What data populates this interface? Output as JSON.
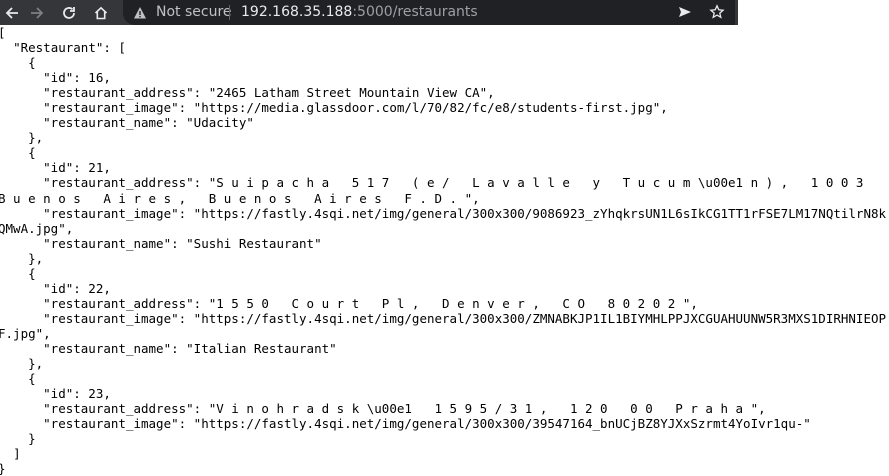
{
  "browser": {
    "security_label": "Not secure",
    "url_host": "192.168.35.188",
    "url_path": ":5000/restaurants"
  },
  "icons": {
    "back": "arrow-left-icon",
    "forward": "arrow-right-icon",
    "reload": "reload-icon",
    "home": "home-icon",
    "security": "warning-triangle-icon",
    "send": "send-icon",
    "bookmark": "star-icon"
  },
  "json_text": "[\n  \"Restaurant\": [\n    {\n      \"id\": 16,\n      \"restaurant_address\": \"2465 Latham Street Mountain View CA\",\n      \"restaurant_image\": \"https://media.glassdoor.com/l/70/82/fc/e8/students-first.jpg\",\n      \"restaurant_name\": \"Udacity\"\n    },\n    {\n      \"id\": 21,\n      \"restaurant_address\": \"S u i p a c h a   5 1 7   ( e /   L a v a l l e   y   T u c u m \\u00e1 n ) ,   1 0 0 3   B u e n o s   A i r e s ,   B u e n o s   A i r e s   F . D . \",\n      \"restaurant_image\": \"https://fastly.4sqi.net/img/general/300x300/9086923_zYhqkrsUN1L6sIkCG1TT1rFSE7LM17NQtilrN8kQMwA.jpg\",\n      \"restaurant_name\": \"Sushi Restaurant\"\n    },\n    {\n      \"id\": 22,\n      \"restaurant_address\": \"1 5 5 0   C o u r t   P l ,   D e n v e r ,   C O   8 0 2 0 2 \",\n      \"restaurant_image\": \"https://fastly.4sqi.net/img/general/300x300/ZMNABKJP1IL1BIYMHLPPJXCGUAHUUNW5R3MXS1DIRHNIEOPF.jpg\",\n      \"restaurant_name\": \"Italian Restaurant\"\n    },\n    {\n      \"id\": 23,\n      \"restaurant_address\": \"V i n o h r a d s k \\u00e1   1 5 9 5 / 3 1 ,   1 2 0   0 0   P r a h a \",\n      \"restaurant_image\": \"https://fastly.4sqi.net/img/general/300x300/39547164_bnUCjBZ8YJXxSzrmt4YoIvr1qu-\"\n    }\n  ]\n}"
}
